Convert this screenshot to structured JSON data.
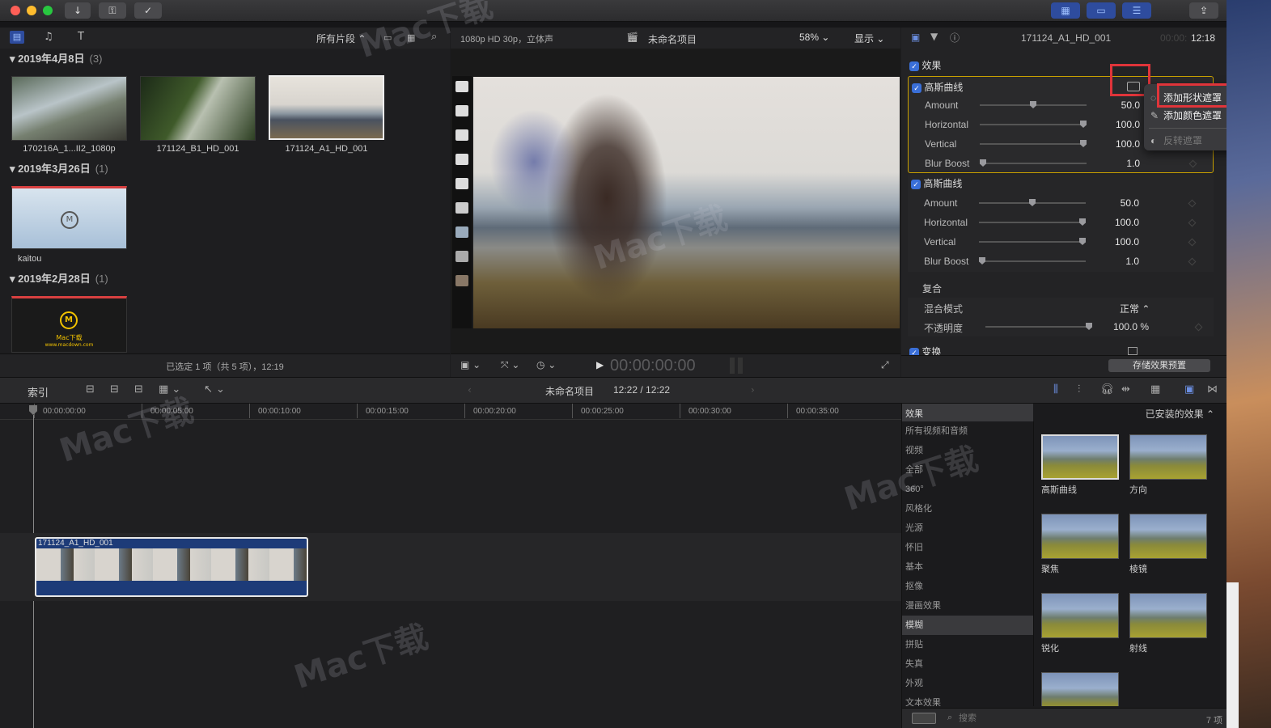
{
  "toolbar": {
    "colors": {
      "close": "#ff5f57",
      "min": "#febc2e",
      "max": "#28c840"
    },
    "icons": [
      "import-icon",
      "key-icon",
      "check-circle-icon"
    ],
    "right_icons": [
      "browser-layout-icon",
      "timeline-layout-icon",
      "inspector-layout-icon",
      "share-icon"
    ]
  },
  "browser": {
    "filter_label": "所有片段",
    "groups": [
      {
        "date": "2019年4月8日",
        "count": "(3)",
        "clips": [
          "170216A_1...II2_1080p",
          "171124_B1_HD_001",
          "171124_A1_HD_001"
        ]
      },
      {
        "date": "2019年3月26日",
        "count": "(1)",
        "clips": [
          "kaitou"
        ]
      },
      {
        "date": "2019年2月28日",
        "count": "(1)",
        "clips": [
          "Mac下载"
        ]
      }
    ],
    "logo_text": "Mac下载",
    "logo_url": "www.macdown.com",
    "status": "已选定 1 项（共 5 项），12:19"
  },
  "viewer": {
    "format": "1080p HD 30p，立体声",
    "project": "未命名项目",
    "zoom": "58%",
    "display": "显示",
    "timecode": "00:00:00:00"
  },
  "inspector": {
    "clip_name": "171124_A1_HD_001",
    "duration_dim": "00:00:",
    "duration": "12:18",
    "effects_label": "效果",
    "effect1": {
      "name": "高斯曲线",
      "params": [
        {
          "label": "Amount",
          "value": "50.0",
          "pos": 0.5
        },
        {
          "label": "Horizontal",
          "value": "100.0",
          "pos": 1.0
        },
        {
          "label": "Vertical",
          "value": "100.0",
          "pos": 1.0
        },
        {
          "label": "Blur Boost",
          "value": "1.0",
          "pos": 0.0
        }
      ]
    },
    "effect2": {
      "name": "高斯曲线",
      "params": [
        {
          "label": "Amount",
          "value": "50.0",
          "pos": 0.5
        },
        {
          "label": "Horizontal",
          "value": "100.0",
          "pos": 1.0
        },
        {
          "label": "Vertical",
          "value": "100.0",
          "pos": 1.0
        },
        {
          "label": "Blur Boost",
          "value": "1.0",
          "pos": 0.0
        }
      ]
    },
    "composite": {
      "title": "复合",
      "blend_label": "混合模式",
      "blend_value": "正常",
      "opacity_label": "不透明度",
      "opacity_value": "100.0 %"
    },
    "transform_label": "变换",
    "save_preset": "存储效果预置"
  },
  "mask_menu": {
    "items": [
      {
        "label": "添加形状遮罩",
        "icon": "shape-mask-icon"
      },
      {
        "label": "添加颜色遮罩",
        "icon": "eyedropper-icon"
      },
      {
        "label": "反转遮罩",
        "icon": "invert-mask-icon"
      }
    ]
  },
  "timeline_bar": {
    "index_label": "索引",
    "project": "未命名项目",
    "position": "12:22 / 12:22"
  },
  "timeline": {
    "ticks": [
      "00:00:00:00",
      "00:00:05:00",
      "00:00:10:00",
      "00:00:15:00",
      "00:00:20:00",
      "00:00:25:00",
      "00:00:30:00",
      "00:00:35:00"
    ],
    "clip_name": "171124_A1_HD_001"
  },
  "effects_browser": {
    "header": "效果",
    "installed": "已安装的效果",
    "categories": [
      "所有视频和音频",
      "视频",
      "全部",
      "360°",
      "风格化",
      "光源",
      "怀旧",
      "基本",
      "抠像",
      "漫画效果",
      "模糊",
      "拼贴",
      "失真",
      "外观",
      "文本效果"
    ],
    "selected_category": "模糊",
    "items": [
      "高斯曲线",
      "方向",
      "聚焦",
      "棱镜",
      "锐化",
      "射线",
      ""
    ],
    "search_placeholder": "搜索",
    "count": "7 项"
  },
  "watermarks": [
    "Mac下载",
    "www.Macdown.com"
  ]
}
